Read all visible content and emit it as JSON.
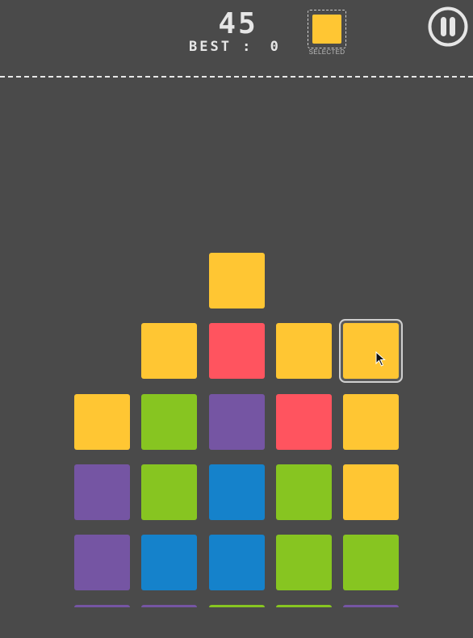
{
  "header": {
    "score": "45",
    "best_label": "BEST :",
    "best_value": "0",
    "selected_label": "SELECTED",
    "selected_color": "yellow"
  },
  "colors": {
    "background": "#4a4a4a",
    "yellow": "#ffc633",
    "red": "#ff545f",
    "green": "#87c521",
    "purple": "#7555a3",
    "blue": "#1582cb"
  },
  "board": {
    "columns": 5,
    "rows": [
      [
        null,
        null,
        "yellow",
        null,
        null
      ],
      [
        null,
        "yellow",
        "red",
        "yellow",
        "yellow"
      ],
      [
        "yellow",
        "green",
        "purple",
        "red",
        "yellow"
      ],
      [
        "purple",
        "green",
        "blue",
        "green",
        "yellow"
      ],
      [
        "purple",
        "blue",
        "blue",
        "green",
        "green"
      ],
      [
        "purple",
        "purple",
        "green",
        "green",
        "purple"
      ]
    ],
    "selected_tile": {
      "row": 1,
      "col": 4
    }
  },
  "icons": {
    "pause": "pause-icon",
    "cursor": "mouse-pointer-icon"
  }
}
